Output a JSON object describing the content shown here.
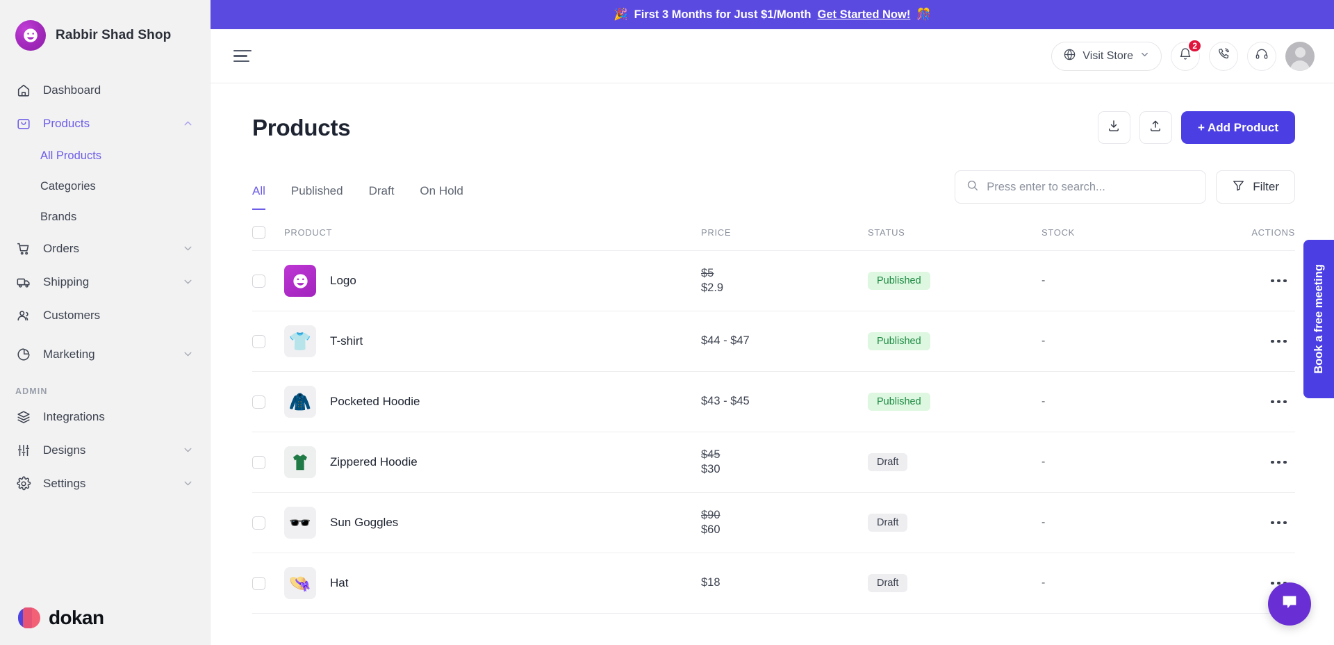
{
  "sidebar": {
    "brand": {
      "name": "Rabbir Shad Shop",
      "logo_icon": "smiley-face-icon"
    },
    "items": [
      {
        "label": "Dashboard",
        "icon": "home-icon"
      },
      {
        "label": "Products",
        "icon": "bag-icon",
        "expanded": true
      },
      {
        "label": "Orders",
        "icon": "cart-icon"
      },
      {
        "label": "Shipping",
        "icon": "truck-icon"
      },
      {
        "label": "Customers",
        "icon": "users-icon"
      },
      {
        "label": "Marketing",
        "icon": "pie-chart-icon"
      }
    ],
    "sub_items": [
      {
        "label": "All Products",
        "active": true
      },
      {
        "label": "Categories",
        "active": false
      },
      {
        "label": "Brands",
        "active": false
      }
    ],
    "admin_section_label": "ADMIN",
    "admin_items": [
      {
        "label": "Integrations",
        "icon": "layers-icon"
      },
      {
        "label": "Designs",
        "icon": "sliders-icon"
      },
      {
        "label": "Settings",
        "icon": "gear-icon"
      }
    ],
    "footer_logo_text": "dokan"
  },
  "promo": {
    "emoji_left": "🎉",
    "text": "First 3 Months for Just $1/Month",
    "link": "Get Started Now!",
    "emoji_right": "🎊",
    "bg_color": "#5b4ae0"
  },
  "topbar": {
    "menu_icon": "hamburger-icon",
    "visit_store_label": "Visit Store",
    "notification_count": "2",
    "icons": [
      "globe-icon",
      "bell-icon",
      "phone-icon",
      "headset-icon",
      "avatar"
    ]
  },
  "page": {
    "title": "Products",
    "import_icon": "download-icon",
    "export_icon": "upload-icon",
    "add_product_label": "+ Add Product",
    "add_product_color": "#4b3fe4"
  },
  "tabs": [
    {
      "label": "All",
      "active": true
    },
    {
      "label": "Published",
      "active": false
    },
    {
      "label": "Draft",
      "active": false
    },
    {
      "label": "On Hold",
      "active": false
    }
  ],
  "search": {
    "placeholder": "Press enter to search...",
    "value": "",
    "icon": "search-icon"
  },
  "filter": {
    "label": "Filter",
    "icon": "funnel-icon"
  },
  "table": {
    "columns": [
      "PRODUCT",
      "PRICE",
      "STATUS",
      "STOCK",
      "ACTIONS"
    ],
    "rows": [
      {
        "name": "Logo",
        "thumb": "logo-thumb",
        "price_old": "$5",
        "price_new": "$2.9",
        "price": "",
        "status": "Published",
        "status_type": "published",
        "stock": "-"
      },
      {
        "name": "T-shirt",
        "thumb": "tshirt-thumb",
        "price_old": "",
        "price_new": "",
        "price": "$44 - $47",
        "status": "Published",
        "status_type": "published",
        "stock": "-"
      },
      {
        "name": "Pocketed Hoodie",
        "thumb": "hoodie-blue-thumb",
        "price_old": "",
        "price_new": "",
        "price": "$43 - $45",
        "status": "Published",
        "status_type": "published",
        "stock": "-"
      },
      {
        "name": "Zippered Hoodie",
        "thumb": "hoodie-green-thumb",
        "price_old": "$45",
        "price_new": "$30",
        "price": "",
        "status": "Draft",
        "status_type": "draft",
        "stock": "-"
      },
      {
        "name": "Sun Goggles",
        "thumb": "sunglasses-thumb",
        "price_old": "$90",
        "price_new": "$60",
        "price": "",
        "status": "Draft",
        "status_type": "draft",
        "stock": "-"
      },
      {
        "name": "Hat",
        "thumb": "hat-thumb",
        "price_old": "",
        "price_new": "",
        "price": "$18",
        "status": "Draft",
        "status_type": "draft",
        "stock": "-"
      }
    ]
  },
  "floating": {
    "book_meeting_label": "Book a free meeting",
    "book_meeting_color": "#4b3fe4",
    "chat_icon": "chat-bubble-icon",
    "chat_color": "#6a2fd4"
  }
}
